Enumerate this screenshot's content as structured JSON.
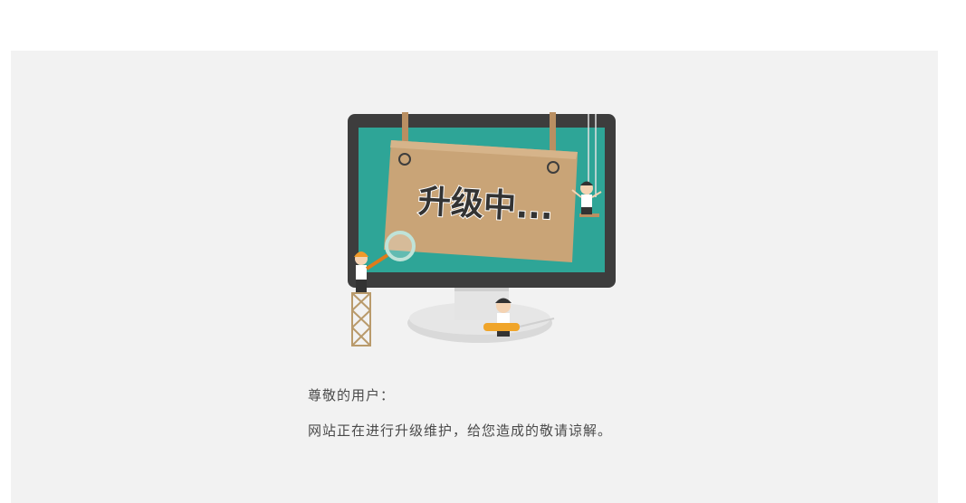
{
  "maintenance": {
    "sign_text": "升级中...",
    "greeting": "尊敬的用户：",
    "message": "网站正在进行升级维护，给您造成的敬请谅解。"
  },
  "colors": {
    "background": "#ffffff",
    "panel": "#f2f2f2",
    "monitor_frame": "#3d3d3d",
    "monitor_screen": "#2ea597",
    "sign_board": "#c9a477",
    "stand": "#d5d5d5",
    "text": "#4a4a4a"
  }
}
